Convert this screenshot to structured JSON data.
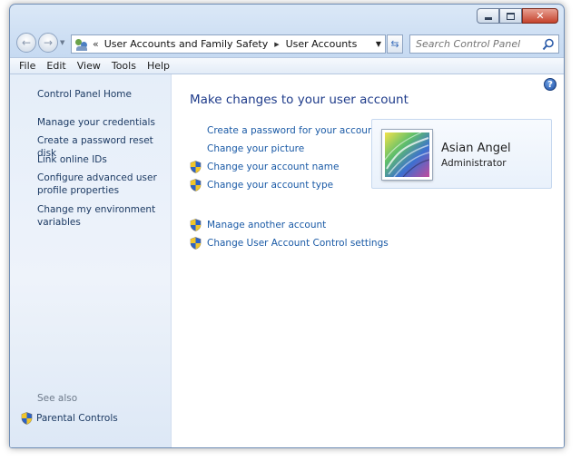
{
  "window": {
    "breadcrumb": [
      "User Accounts and Family Safety",
      "User Accounts"
    ],
    "search_placeholder": "Search Control Panel"
  },
  "menu": {
    "items": [
      "File",
      "Edit",
      "View",
      "Tools",
      "Help"
    ]
  },
  "sidebar": {
    "home": "Control Panel Home",
    "links": [
      "Manage your credentials",
      "Create a password reset disk",
      "Link online IDs",
      "Configure advanced user profile properties",
      "Change my environment variables"
    ],
    "see_also_label": "See also",
    "see_also_items": [
      "Parental Controls"
    ]
  },
  "main": {
    "title": "Make changes to your user account",
    "tasks": [
      {
        "label": "Create a password for your account",
        "shield": false
      },
      {
        "label": "Change your picture",
        "shield": false
      },
      {
        "label": "Change your account name",
        "shield": true
      },
      {
        "label": "Change your account type",
        "shield": true
      }
    ],
    "other_tasks": [
      {
        "label": "Manage another account",
        "shield": true
      },
      {
        "label": "Change User Account Control settings",
        "shield": true
      }
    ]
  },
  "account": {
    "name": "Asian Angel",
    "role": "Administrator"
  },
  "colors": {
    "link": "#1a5aa6",
    "title": "#1e3b8a",
    "sidebar_link": "#1c3a63"
  },
  "icons": {
    "help": "?",
    "refresh": "⇆",
    "dropdown": "▼"
  }
}
